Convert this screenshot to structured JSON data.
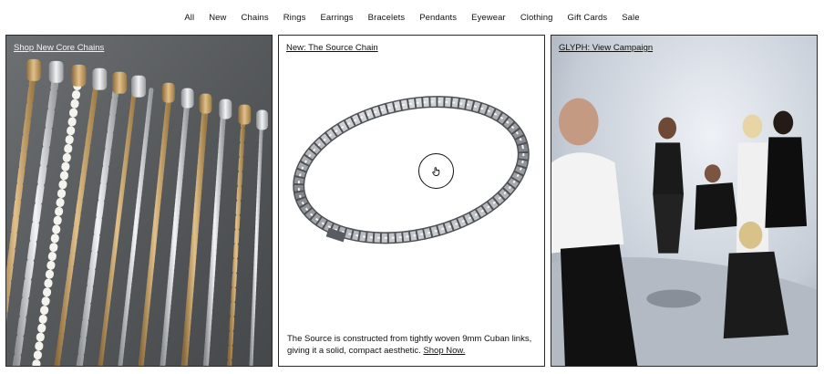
{
  "nav": {
    "items": [
      "All",
      "New",
      "Chains",
      "Rings",
      "Earrings",
      "Bracelets",
      "Pendants",
      "Eyewear",
      "Clothing",
      "Gift Cards",
      "Sale"
    ]
  },
  "panels": {
    "left": {
      "link": "Shop New Core Chains"
    },
    "center": {
      "link": "New: The Source Chain",
      "caption": "The Source is constructed from tightly woven 9mm Cuban links, giving it a solid, compact aesthetic.",
      "shop_label": "Shop Now."
    },
    "right": {
      "link": "GLYPH: View Campaign"
    }
  },
  "icons": {
    "quick_view": "hand-pointer-icon"
  }
}
